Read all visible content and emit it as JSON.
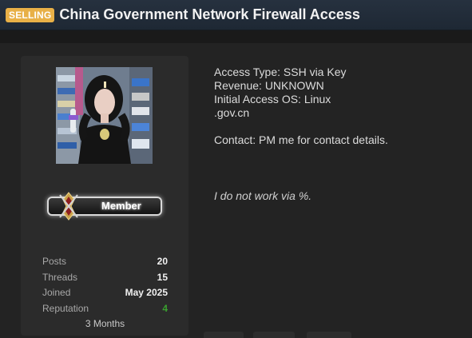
{
  "thread": {
    "prefix": "SELLING",
    "title": "China Government Network Firewall Access"
  },
  "user": {
    "rank": "Member",
    "stats": [
      {
        "label": "Posts",
        "value": "20"
      },
      {
        "label": "Threads",
        "value": "15"
      },
      {
        "label": "Joined",
        "value": "May 2025"
      },
      {
        "label": "Reputation",
        "value": "4"
      }
    ],
    "membership_duration": "3 Months"
  },
  "post": {
    "lines": [
      "Access Type: SSH via Key",
      "Revenue: UNKNOWN",
      "Initial Access OS: Linux",
      ".gov.cn"
    ],
    "contact": "Contact: PM me for contact details.",
    "signature": "I do not work via %."
  },
  "colors": {
    "prefix_badge": "#e8b047",
    "title_bar": "#26313f",
    "reputation_positive": "#3aa12f",
    "background": "#232323"
  }
}
